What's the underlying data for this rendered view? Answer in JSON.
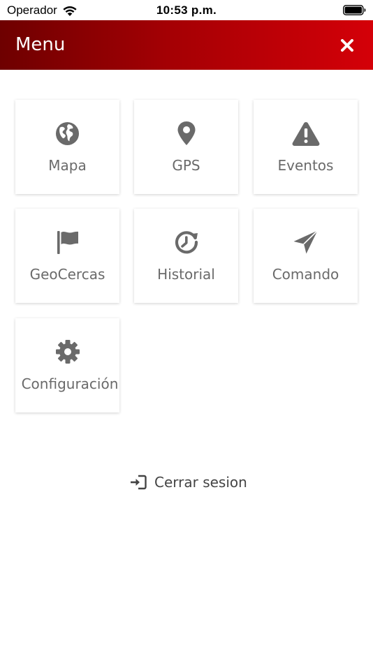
{
  "status_bar": {
    "carrier": "Operador",
    "time": "10:53 p.m."
  },
  "header": {
    "title": "Menu",
    "close_icon": "close-icon"
  },
  "menu": {
    "items": [
      {
        "label": "Mapa",
        "icon": "globe-icon"
      },
      {
        "label": "GPS",
        "icon": "map-marker-icon"
      },
      {
        "label": "Eventos",
        "icon": "warning-triangle-icon"
      },
      {
        "label": "GeoCercas",
        "icon": "flag-icon"
      },
      {
        "label": "Historial",
        "icon": "history-icon"
      },
      {
        "label": "Comando",
        "icon": "paper-plane-icon"
      },
      {
        "label": "Configuración",
        "icon": "gear-icon"
      }
    ]
  },
  "logout": {
    "label": "Cerrar sesion",
    "icon": "sign-in-icon"
  },
  "colors": {
    "header_start": "#6e0000",
    "header_end": "#d40008",
    "icon": "#6a6a6a",
    "text": "#6a6a6a"
  }
}
